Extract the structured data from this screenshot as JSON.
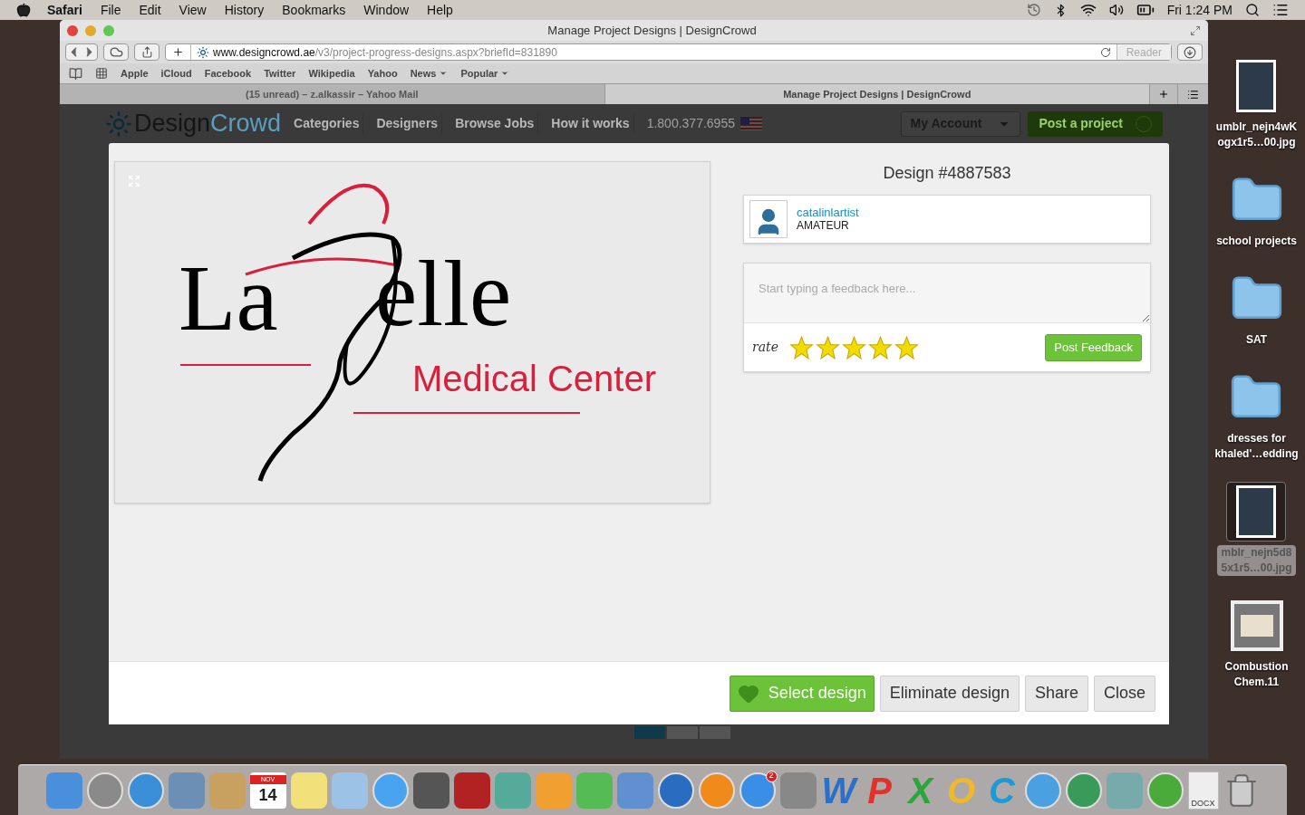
{
  "menu_bar": {
    "app": "Safari",
    "items": [
      "File",
      "Edit",
      "View",
      "History",
      "Bookmarks",
      "Window",
      "Help"
    ],
    "clock": "Fri 1:24 PM"
  },
  "window": {
    "title": "Manage Project Designs | DesignCrowd",
    "address": {
      "domain": "www.designcrowd.ae",
      "path": "/v3/project-progress-designs.aspx?briefId=831890",
      "reader": "Reader"
    },
    "bookmarks": [
      {
        "label": "Apple",
        "menu": false
      },
      {
        "label": "iCloud",
        "menu": false
      },
      {
        "label": "Facebook",
        "menu": false
      },
      {
        "label": "Twitter",
        "menu": false
      },
      {
        "label": "Wikipedia",
        "menu": false
      },
      {
        "label": "Yahoo",
        "menu": false
      },
      {
        "label": "News",
        "menu": true
      },
      {
        "label": "Popular",
        "menu": true
      }
    ],
    "tabs": [
      {
        "label": "(15 unread) – z.alkassir – Yahoo Mail",
        "selected": false
      },
      {
        "label": "Manage Project Designs | DesignCrowd",
        "selected": true
      }
    ]
  },
  "site_header": {
    "logo_left": "Design",
    "logo_right": "Crowd",
    "nav": [
      "Categories",
      "Designers",
      "Browse Jobs",
      "How it works"
    ],
    "phone": "1.800.377.6955",
    "account": "My Account",
    "post": "Post a project"
  },
  "modal": {
    "logo": {
      "word_left": "La",
      "word_right": "elle",
      "tagline": "Medical Center"
    },
    "title": "Design #4887583",
    "designer": {
      "name": "catalinlartist",
      "level": "AMATEUR"
    },
    "feedback": {
      "placeholder": "Start typing a feedback here...",
      "rate_label": "rate",
      "stars": 5,
      "button": "Post Feedback"
    },
    "actions": [
      {
        "label": "Select design",
        "kind": "primary"
      },
      {
        "label": "Eliminate design",
        "kind": "plain"
      },
      {
        "label": "Share",
        "kind": "plain"
      },
      {
        "label": "Close",
        "kind": "plain"
      }
    ]
  },
  "desktop": [
    {
      "kind": "image",
      "lines": [
        "umblr_nejn4wK",
        "ogx1r5…00.jpg"
      ],
      "selected": false
    },
    {
      "kind": "folder",
      "lines": [
        "school projects"
      ],
      "selected": false
    },
    {
      "kind": "folder",
      "lines": [
        "SAT"
      ],
      "selected": false
    },
    {
      "kind": "folder",
      "lines": [
        "dresses for",
        "khaled'…edding"
      ],
      "selected": false
    },
    {
      "kind": "image",
      "lines": [
        "mblr_nejn5d8",
        "5x1r5…00.jpg"
      ],
      "selected": true
    },
    {
      "kind": "document",
      "lines": [
        "Combustion",
        "Chem.11"
      ],
      "selected": false
    }
  ],
  "dock": [
    {
      "kind": "tile",
      "color": "#4a8fdc"
    },
    {
      "kind": "round",
      "color": "#8a8a8a"
    },
    {
      "kind": "round",
      "color": "#3b8ed8"
    },
    {
      "kind": "tile",
      "color": "#6b8fb5"
    },
    {
      "kind": "tile",
      "color": "#c8a060"
    },
    {
      "kind": "calendar",
      "month": "NOV",
      "day": "14"
    },
    {
      "kind": "tile",
      "color": "#f2e07a"
    },
    {
      "kind": "tile",
      "color": "#9cc3e6"
    },
    {
      "kind": "round",
      "color": "#4aa3f0"
    },
    {
      "kind": "tile",
      "color": "#555555"
    },
    {
      "kind": "tile",
      "color": "#b22222"
    },
    {
      "kind": "tile",
      "color": "#55aa99"
    },
    {
      "kind": "tile",
      "color": "#f0a030"
    },
    {
      "kind": "tile",
      "color": "#55bb55"
    },
    {
      "kind": "tile",
      "color": "#6090d0"
    },
    {
      "kind": "round",
      "color": "#2a6cc0"
    },
    {
      "kind": "round",
      "color": "#f08a1a"
    },
    {
      "kind": "badge",
      "color": "#3a8ee6",
      "badge": "2"
    },
    {
      "kind": "tile",
      "color": "#888888"
    },
    {
      "kind": "letter",
      "color": "#2a6fc9",
      "label": "W"
    },
    {
      "kind": "letter",
      "color": "#e0312a",
      "label": "P"
    },
    {
      "kind": "letter",
      "color": "#2aa63a",
      "label": "X"
    },
    {
      "kind": "letter",
      "color": "#f0b82a",
      "label": "O"
    },
    {
      "kind": "letter",
      "color": "#1a9ad6",
      "label": "C"
    },
    {
      "kind": "round",
      "color": "#4aa0e0"
    },
    {
      "kind": "round",
      "color": "#3a9a5a"
    },
    {
      "kind": "tile",
      "color": "#77aaaa"
    },
    {
      "kind": "round",
      "color": "#4aaa3a"
    },
    {
      "kind": "file",
      "color": "#eeeeee",
      "label": "DOCX"
    },
    {
      "kind": "trash",
      "color": "#cccccc"
    }
  ]
}
